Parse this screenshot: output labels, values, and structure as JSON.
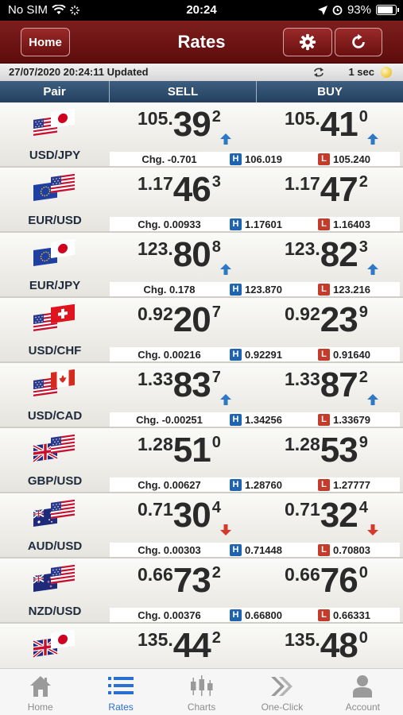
{
  "status_bar": {
    "carrier": "No SIM",
    "time": "20:24",
    "battery": "93%"
  },
  "nav": {
    "home_label": "Home",
    "title": "Rates"
  },
  "update_bar": {
    "timestamp": "27/07/2020 20:24:11",
    "updated_label": "Updated",
    "interval": "1 sec"
  },
  "columns": {
    "pair": "Pair",
    "sell": "SELL",
    "buy": "BUY"
  },
  "quotes": [
    {
      "pair": "USD/JPY",
      "flags": [
        "us",
        "jp"
      ],
      "sell": {
        "small": "105.",
        "big": "39",
        "pip": "2",
        "dir": "up"
      },
      "buy": {
        "small": "105.",
        "big": "41",
        "pip": "0",
        "dir": "up"
      },
      "chg": "Chg. -0.701",
      "high": "106.019",
      "low": "105.240"
    },
    {
      "pair": "EUR/USD",
      "flags": [
        "eu",
        "us"
      ],
      "sell": {
        "small": "1.17",
        "big": "46",
        "pip": "3",
        "dir": ""
      },
      "buy": {
        "small": "1.17",
        "big": "47",
        "pip": "2",
        "dir": ""
      },
      "chg": "Chg. 0.00933",
      "high": "1.17601",
      "low": "1.16403"
    },
    {
      "pair": "EUR/JPY",
      "flags": [
        "eu",
        "jp"
      ],
      "sell": {
        "small": "123.",
        "big": "80",
        "pip": "8",
        "dir": "up"
      },
      "buy": {
        "small": "123.",
        "big": "82",
        "pip": "3",
        "dir": "up"
      },
      "chg": "Chg. 0.178",
      "high": "123.870",
      "low": "123.216"
    },
    {
      "pair": "USD/CHF",
      "flags": [
        "us",
        "ch"
      ],
      "sell": {
        "small": "0.92",
        "big": "20",
        "pip": "7",
        "dir": ""
      },
      "buy": {
        "small": "0.92",
        "big": "23",
        "pip": "9",
        "dir": ""
      },
      "chg": "Chg. 0.00216",
      "high": "0.92291",
      "low": "0.91640"
    },
    {
      "pair": "USD/CAD",
      "flags": [
        "us",
        "ca"
      ],
      "sell": {
        "small": "1.33",
        "big": "83",
        "pip": "7",
        "dir": "up"
      },
      "buy": {
        "small": "1.33",
        "big": "87",
        "pip": "2",
        "dir": "up"
      },
      "chg": "Chg. -0.00251",
      "high": "1.34256",
      "low": "1.33679"
    },
    {
      "pair": "GBP/USD",
      "flags": [
        "gb",
        "us"
      ],
      "sell": {
        "small": "1.28",
        "big": "51",
        "pip": "0",
        "dir": ""
      },
      "buy": {
        "small": "1.28",
        "big": "53",
        "pip": "9",
        "dir": ""
      },
      "chg": "Chg. 0.00627",
      "high": "1.28760",
      "low": "1.27777"
    },
    {
      "pair": "AUD/USD",
      "flags": [
        "au",
        "us"
      ],
      "sell": {
        "small": "0.71",
        "big": "30",
        "pip": "4",
        "dir": "down"
      },
      "buy": {
        "small": "0.71",
        "big": "32",
        "pip": "4",
        "dir": "down"
      },
      "chg": "Chg. 0.00303",
      "high": "0.71448",
      "low": "0.70803"
    },
    {
      "pair": "NZD/USD",
      "flags": [
        "nz",
        "us"
      ],
      "sell": {
        "small": "0.66",
        "big": "73",
        "pip": "2",
        "dir": ""
      },
      "buy": {
        "small": "0.66",
        "big": "76",
        "pip": "0",
        "dir": ""
      },
      "chg": "Chg. 0.00376",
      "high": "0.66800",
      "low": "0.66331"
    },
    {
      "pair": "",
      "flags": [
        "gb",
        "jp"
      ],
      "sell": {
        "small": "135.",
        "big": "44",
        "pip": "2",
        "dir": ""
      },
      "buy": {
        "small": "135.",
        "big": "48",
        "pip": "0",
        "dir": ""
      },
      "chg": "",
      "high": "",
      "low": ""
    }
  ],
  "tabs": [
    {
      "label": "Home",
      "icon": "house-icon",
      "active": false
    },
    {
      "label": "Rates",
      "icon": "list-icon",
      "active": true
    },
    {
      "label": "Charts",
      "icon": "candlestick-icon",
      "active": false
    },
    {
      "label": "One-Click",
      "icon": "double-chevron-icon",
      "active": false
    },
    {
      "label": "Account",
      "icon": "person-icon",
      "active": false
    }
  ],
  "colors": {
    "nav": "#7e1e1e",
    "header": "#2f4e70",
    "up": "#2f78c4",
    "down": "#d33a2c",
    "active_tab": "#2a6fd4"
  }
}
